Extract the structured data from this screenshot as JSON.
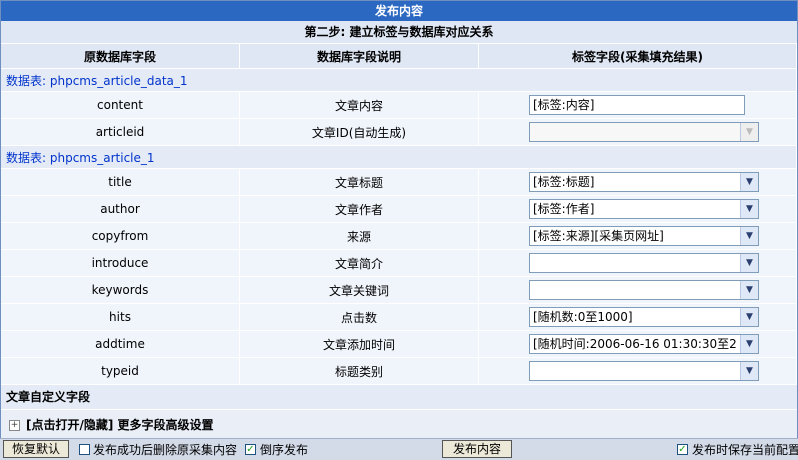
{
  "title": "发布内容",
  "step": "第二步: 建立标签与数据库对应关系",
  "headers": [
    "原数据库字段",
    "数据库字段说明",
    "标签字段(采集填充结果)"
  ],
  "table1": {
    "label": "数据表: phpcms_article_data_1",
    "rows": [
      {
        "field": "content",
        "desc": "文章内容",
        "value": "[标签:内容]"
      },
      {
        "field": "articleid",
        "desc": "文章ID(自动生成)",
        "value": ""
      }
    ]
  },
  "table2": {
    "label": "数据表: phpcms_article_1",
    "rows": [
      {
        "field": "title",
        "desc": "文章标题",
        "value": "[标签:标题]"
      },
      {
        "field": "author",
        "desc": "文章作者",
        "value": "[标签:作者]"
      },
      {
        "field": "copyfrom",
        "desc": "来源",
        "value": "[标签:来源][采集页网址]"
      },
      {
        "field": "introduce",
        "desc": "文章简介",
        "value": ""
      },
      {
        "field": "keywords",
        "desc": "文章关键词",
        "value": ""
      },
      {
        "field": "hits",
        "desc": "点击数",
        "value": "[随机数:0至1000]"
      },
      {
        "field": "addtime",
        "desc": "文章添加时间",
        "value": "[随机时间:2006-06-16 01:30:30至2"
      },
      {
        "field": "typeid",
        "desc": "标题类别",
        "value": ""
      }
    ]
  },
  "custom_section": "文章自定义字段",
  "advanced_toggle": "[点击打开/隐藏] 更多字段高级设置",
  "bottom": {
    "restore_label": "恢复默认",
    "delete_label": "发布成功后删除原采集内容",
    "delete_checked": false,
    "reverse_label": "倒序发布",
    "reverse_checked": true,
    "publish_label": "发布内容",
    "save_label": "发布时保存当前配置",
    "save_checked": true
  }
}
